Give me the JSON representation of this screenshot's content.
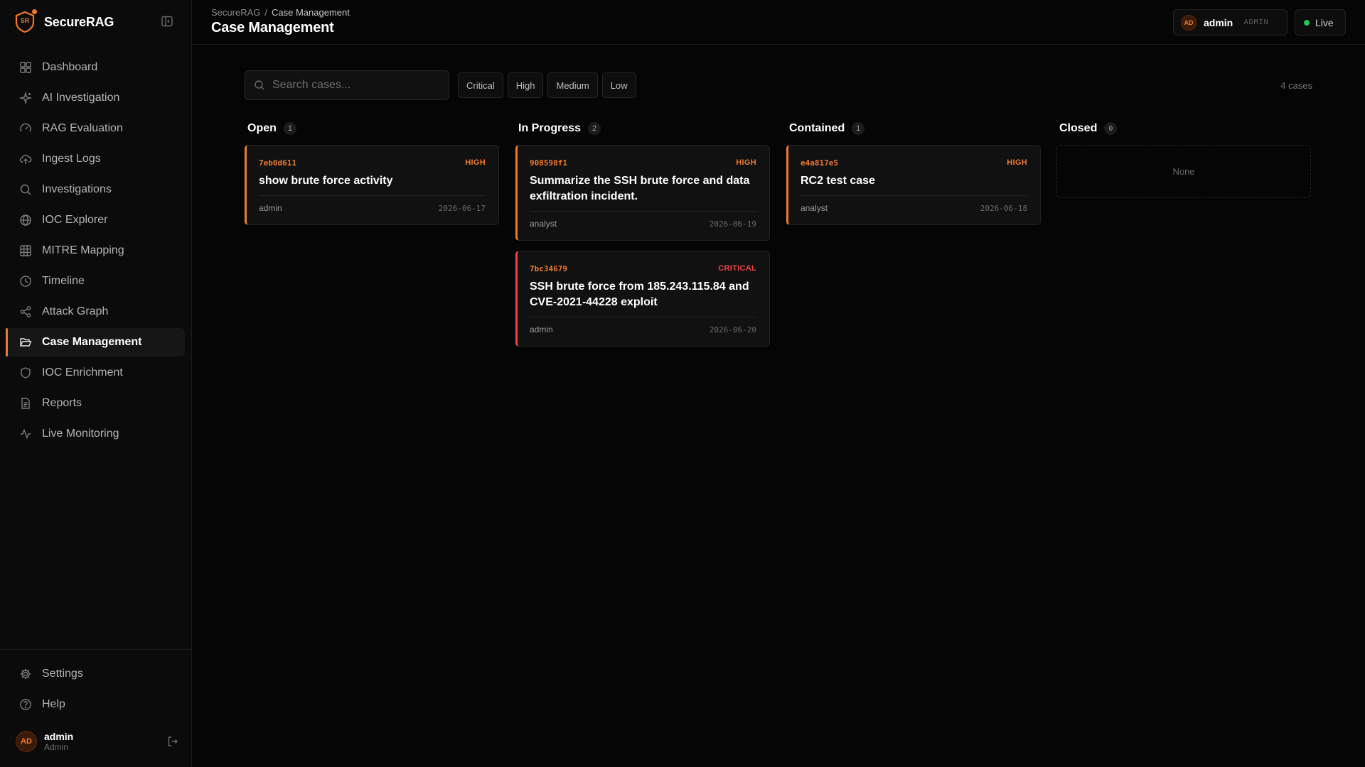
{
  "brand": {
    "name": "SecureRAG",
    "logo_initials": "SR"
  },
  "sidebar": {
    "items": [
      {
        "label": "Dashboard",
        "icon": "dashboard-icon",
        "active": false
      },
      {
        "label": "AI Investigation",
        "icon": "sparkles-icon",
        "active": false
      },
      {
        "label": "RAG Evaluation",
        "icon": "gauge-icon",
        "active": false
      },
      {
        "label": "Ingest Logs",
        "icon": "cloud-upload-icon",
        "active": false
      },
      {
        "label": "Investigations",
        "icon": "search-icon",
        "active": false
      },
      {
        "label": "IOC Explorer",
        "icon": "globe-icon",
        "active": false
      },
      {
        "label": "MITRE Mapping",
        "icon": "grid-icon",
        "active": false
      },
      {
        "label": "Timeline",
        "icon": "clock-icon",
        "active": false
      },
      {
        "label": "Attack Graph",
        "icon": "share-icon",
        "active": false
      },
      {
        "label": "Case Management",
        "icon": "folder-open-icon",
        "active": true
      },
      {
        "label": "IOC Enrichment",
        "icon": "shield-icon",
        "active": false
      },
      {
        "label": "Reports",
        "icon": "file-text-icon",
        "active": false
      },
      {
        "label": "Live Monitoring",
        "icon": "activity-icon",
        "active": false
      }
    ],
    "footer_items": [
      {
        "label": "Settings",
        "icon": "gear-icon"
      },
      {
        "label": "Help",
        "icon": "help-circle-icon"
      }
    ],
    "user": {
      "initials": "AD",
      "name": "admin",
      "role": "Admin"
    }
  },
  "header": {
    "breadcrumb_root": "SecureRAG",
    "breadcrumb_sep": "/",
    "breadcrumb_current": "Case Management",
    "title": "Case Management",
    "user": {
      "initials": "AD",
      "name": "admin",
      "sep": "·",
      "role": "ADMIN"
    },
    "live_label": "Live"
  },
  "toolbar": {
    "search_placeholder": "Search cases...",
    "filters": [
      "Critical",
      "High",
      "Medium",
      "Low"
    ],
    "case_count": "4 cases"
  },
  "board": {
    "columns": [
      {
        "title": "Open",
        "count": "1",
        "cards": [
          {
            "id": "7eb0d611",
            "severity": "HIGH",
            "title": "show brute force activity",
            "assignee": "admin",
            "date": "2026-06-17"
          }
        ]
      },
      {
        "title": "In Progress",
        "count": "2",
        "cards": [
          {
            "id": "908598f1",
            "severity": "HIGH",
            "title": "Summarize the SSH brute force and data exfiltration incident.",
            "assignee": "analyst",
            "date": "2026-06-19"
          },
          {
            "id": "7bc34679",
            "severity": "CRITICAL",
            "title": "SSH brute force from 185.243.115.84 and CVE-2021-44228 exploit",
            "assignee": "admin",
            "date": "2026-06-20"
          }
        ]
      },
      {
        "title": "Contained",
        "count": "1",
        "cards": [
          {
            "id": "e4a817e5",
            "severity": "HIGH",
            "title": "RC2 test case",
            "assignee": "analyst",
            "date": "2026-06-18"
          }
        ]
      },
      {
        "title": "Closed",
        "count": "0",
        "empty_label": "None",
        "cards": []
      }
    ]
  },
  "colors": {
    "accent": "#f07a2a",
    "critical": "#ef4444",
    "live": "#22c55e",
    "background": "#050505"
  }
}
